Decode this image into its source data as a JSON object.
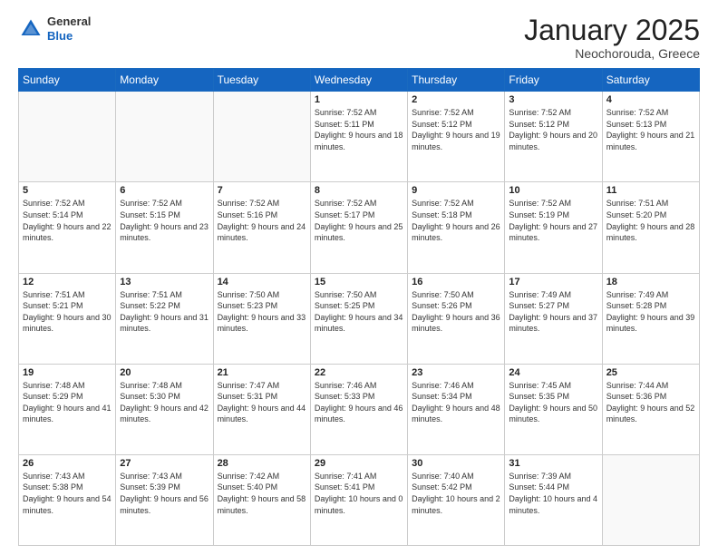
{
  "header": {
    "logo": {
      "general": "General",
      "blue": "Blue"
    },
    "title": "January 2025",
    "location": "Neochorouda, Greece"
  },
  "weekdays": [
    "Sunday",
    "Monday",
    "Tuesday",
    "Wednesday",
    "Thursday",
    "Friday",
    "Saturday"
  ],
  "weeks": [
    [
      {
        "day": "",
        "empty": true
      },
      {
        "day": "",
        "empty": true
      },
      {
        "day": "",
        "empty": true
      },
      {
        "day": "1",
        "sunrise": "7:52 AM",
        "sunset": "5:11 PM",
        "daylight": "9 hours and 18 minutes."
      },
      {
        "day": "2",
        "sunrise": "7:52 AM",
        "sunset": "5:12 PM",
        "daylight": "9 hours and 19 minutes."
      },
      {
        "day": "3",
        "sunrise": "7:52 AM",
        "sunset": "5:12 PM",
        "daylight": "9 hours and 20 minutes."
      },
      {
        "day": "4",
        "sunrise": "7:52 AM",
        "sunset": "5:13 PM",
        "daylight": "9 hours and 21 minutes."
      }
    ],
    [
      {
        "day": "5",
        "sunrise": "7:52 AM",
        "sunset": "5:14 PM",
        "daylight": "9 hours and 22 minutes."
      },
      {
        "day": "6",
        "sunrise": "7:52 AM",
        "sunset": "5:15 PM",
        "daylight": "9 hours and 23 minutes."
      },
      {
        "day": "7",
        "sunrise": "7:52 AM",
        "sunset": "5:16 PM",
        "daylight": "9 hours and 24 minutes."
      },
      {
        "day": "8",
        "sunrise": "7:52 AM",
        "sunset": "5:17 PM",
        "daylight": "9 hours and 25 minutes."
      },
      {
        "day": "9",
        "sunrise": "7:52 AM",
        "sunset": "5:18 PM",
        "daylight": "9 hours and 26 minutes."
      },
      {
        "day": "10",
        "sunrise": "7:52 AM",
        "sunset": "5:19 PM",
        "daylight": "9 hours and 27 minutes."
      },
      {
        "day": "11",
        "sunrise": "7:51 AM",
        "sunset": "5:20 PM",
        "daylight": "9 hours and 28 minutes."
      }
    ],
    [
      {
        "day": "12",
        "sunrise": "7:51 AM",
        "sunset": "5:21 PM",
        "daylight": "9 hours and 30 minutes."
      },
      {
        "day": "13",
        "sunrise": "7:51 AM",
        "sunset": "5:22 PM",
        "daylight": "9 hours and 31 minutes."
      },
      {
        "day": "14",
        "sunrise": "7:50 AM",
        "sunset": "5:23 PM",
        "daylight": "9 hours and 33 minutes."
      },
      {
        "day": "15",
        "sunrise": "7:50 AM",
        "sunset": "5:25 PM",
        "daylight": "9 hours and 34 minutes."
      },
      {
        "day": "16",
        "sunrise": "7:50 AM",
        "sunset": "5:26 PM",
        "daylight": "9 hours and 36 minutes."
      },
      {
        "day": "17",
        "sunrise": "7:49 AM",
        "sunset": "5:27 PM",
        "daylight": "9 hours and 37 minutes."
      },
      {
        "day": "18",
        "sunrise": "7:49 AM",
        "sunset": "5:28 PM",
        "daylight": "9 hours and 39 minutes."
      }
    ],
    [
      {
        "day": "19",
        "sunrise": "7:48 AM",
        "sunset": "5:29 PM",
        "daylight": "9 hours and 41 minutes."
      },
      {
        "day": "20",
        "sunrise": "7:48 AM",
        "sunset": "5:30 PM",
        "daylight": "9 hours and 42 minutes."
      },
      {
        "day": "21",
        "sunrise": "7:47 AM",
        "sunset": "5:31 PM",
        "daylight": "9 hours and 44 minutes."
      },
      {
        "day": "22",
        "sunrise": "7:46 AM",
        "sunset": "5:33 PM",
        "daylight": "9 hours and 46 minutes."
      },
      {
        "day": "23",
        "sunrise": "7:46 AM",
        "sunset": "5:34 PM",
        "daylight": "9 hours and 48 minutes."
      },
      {
        "day": "24",
        "sunrise": "7:45 AM",
        "sunset": "5:35 PM",
        "daylight": "9 hours and 50 minutes."
      },
      {
        "day": "25",
        "sunrise": "7:44 AM",
        "sunset": "5:36 PM",
        "daylight": "9 hours and 52 minutes."
      }
    ],
    [
      {
        "day": "26",
        "sunrise": "7:43 AM",
        "sunset": "5:38 PM",
        "daylight": "9 hours and 54 minutes."
      },
      {
        "day": "27",
        "sunrise": "7:43 AM",
        "sunset": "5:39 PM",
        "daylight": "9 hours and 56 minutes."
      },
      {
        "day": "28",
        "sunrise": "7:42 AM",
        "sunset": "5:40 PM",
        "daylight": "9 hours and 58 minutes."
      },
      {
        "day": "29",
        "sunrise": "7:41 AM",
        "sunset": "5:41 PM",
        "daylight": "10 hours and 0 minutes."
      },
      {
        "day": "30",
        "sunrise": "7:40 AM",
        "sunset": "5:42 PM",
        "daylight": "10 hours and 2 minutes."
      },
      {
        "day": "31",
        "sunrise": "7:39 AM",
        "sunset": "5:44 PM",
        "daylight": "10 hours and 4 minutes."
      },
      {
        "day": "",
        "empty": true
      }
    ]
  ]
}
